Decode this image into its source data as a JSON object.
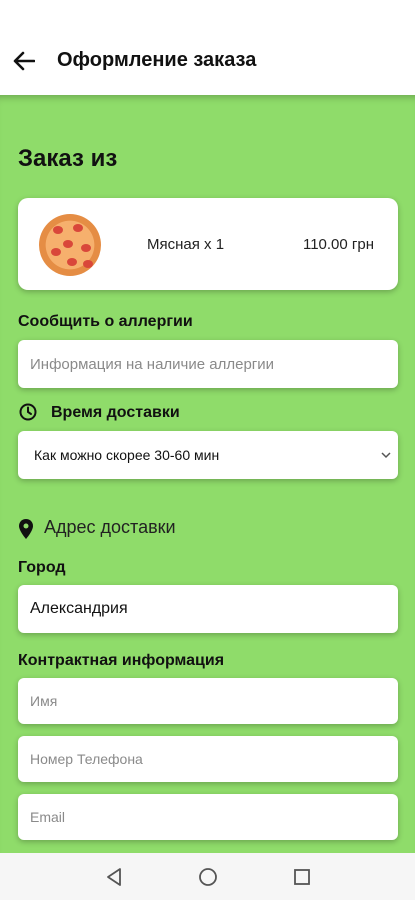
{
  "header": {
    "title": "Оформление заказа"
  },
  "order": {
    "heading": "Заказ из",
    "item_name": "Мясная х 1",
    "item_price": "110.00 грн"
  },
  "allergy": {
    "label": "Сообщить о аллергии",
    "placeholder": "Информация на наличие аллергии"
  },
  "delivery_time": {
    "label": "Время доставки",
    "selected": "Как можно скорее 30-60 мин"
  },
  "address": {
    "heading": "Адрес доставки",
    "city_label": "Город",
    "city_value": "Александрия"
  },
  "contact": {
    "label": "Контрактная информация",
    "name_placeholder": "Имя",
    "phone_placeholder": "Номер Телефона",
    "email_placeholder": "Email"
  },
  "colors": {
    "background": "#8fdc6a",
    "card": "#ffffff",
    "text": "#111111"
  },
  "icons": [
    "arrow-left-icon",
    "clock-icon",
    "location-pin-icon",
    "chevron-down-icon",
    "nav-back-icon",
    "nav-home-icon",
    "nav-recents-icon"
  ]
}
